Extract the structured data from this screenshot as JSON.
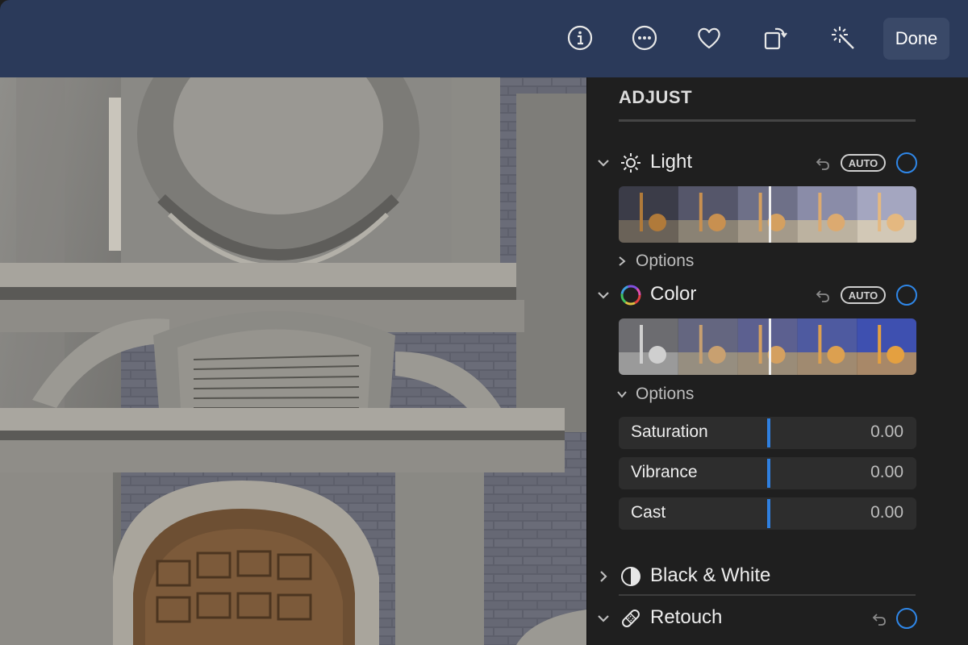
{
  "toolbar": {
    "buttons": [
      {
        "name": "info-button",
        "icon": "info-icon"
      },
      {
        "name": "more-button",
        "icon": "ellipsis-icon"
      },
      {
        "name": "favorite-button",
        "icon": "heart-icon"
      },
      {
        "name": "rotate-button",
        "icon": "rotate-icon"
      },
      {
        "name": "enhance-button",
        "icon": "magic-wand-icon"
      }
    ],
    "done_label": "Done"
  },
  "panel": {
    "title": "ADJUST",
    "sections": {
      "light": {
        "label": "Light",
        "auto_label": "AUTO",
        "options_label": "Options",
        "expanded": true,
        "options_expanded": false
      },
      "color": {
        "label": "Color",
        "auto_label": "AUTO",
        "options_label": "Options",
        "expanded": true,
        "options_expanded": true
      },
      "bw": {
        "label": "Black & White",
        "expanded": false
      },
      "retouch": {
        "label": "Retouch",
        "expanded": true
      }
    },
    "color_sliders": [
      {
        "label": "Saturation",
        "value": "0.00"
      },
      {
        "label": "Vibrance",
        "value": "0.00"
      },
      {
        "label": "Cast",
        "value": "0.00"
      }
    ]
  },
  "colors": {
    "toolbar_bg": "#2b3a5a",
    "panel_bg": "#1f1f1f",
    "accent_blue": "#2f87e8"
  }
}
